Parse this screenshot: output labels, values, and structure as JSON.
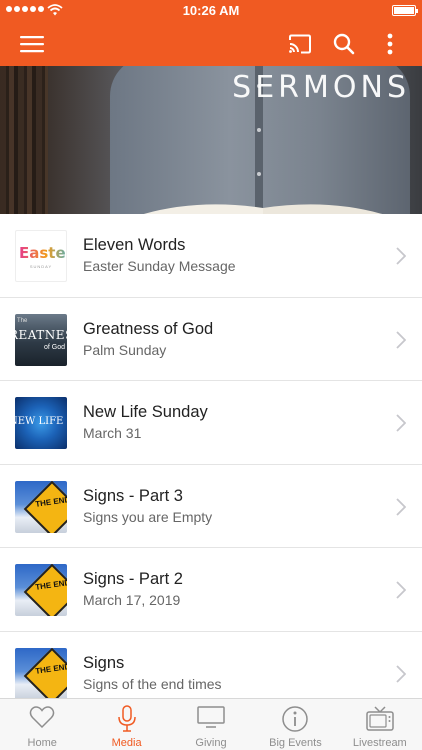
{
  "status_bar": {
    "time": "10:26 AM"
  },
  "hero": {
    "title": "SERMONS"
  },
  "sermons": [
    {
      "title": "Eleven Words",
      "subtitle": "Easter Sunday Message",
      "thumb_text": "Easter",
      "thumb_sub": "SUNDAY"
    },
    {
      "title": "Greatness of God",
      "subtitle": "Palm Sunday",
      "thumb_top": "The",
      "thumb_text": "REATNESS",
      "thumb_sub": "of God"
    },
    {
      "title": "New Life Sunday",
      "subtitle": "March 31",
      "thumb_text": "NEW LIFE SUNDAY"
    },
    {
      "title": "Signs - Part 3",
      "subtitle": "Signs you are Empty",
      "thumb_text": "THE END IS NEAR"
    },
    {
      "title": "Signs - Part 2",
      "subtitle": "March 17, 2019",
      "thumb_text": "THE END IS NEAR"
    },
    {
      "title": "Signs",
      "subtitle": "Signs of the end times",
      "thumb_text": "THE END IS NEAR"
    }
  ],
  "tabs": [
    {
      "label": "Home",
      "icon": "heart-icon"
    },
    {
      "label": "Media",
      "icon": "microphone-icon",
      "active": true
    },
    {
      "label": "Giving",
      "icon": "monitor-icon"
    },
    {
      "label": "Big Events",
      "icon": "info-icon"
    },
    {
      "label": "Livestream",
      "icon": "tv-icon"
    }
  ],
  "colors": {
    "accent": "#f05a22",
    "inactive": "#8e8e8e"
  }
}
